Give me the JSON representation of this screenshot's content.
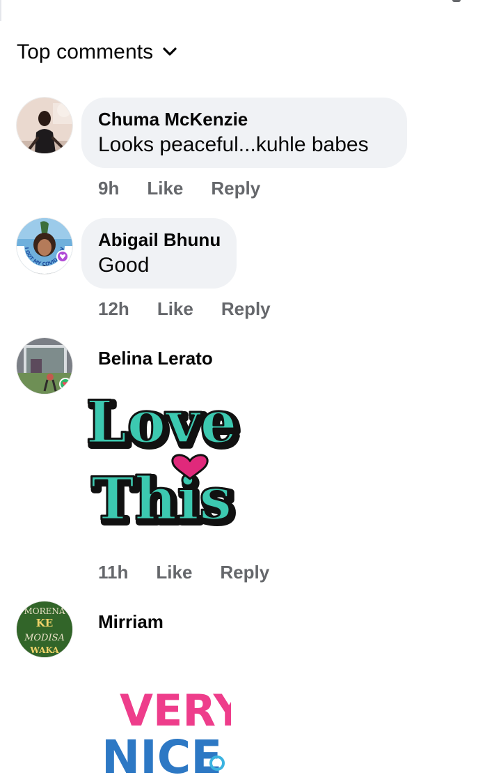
{
  "header": {
    "sort_label": "Top comments"
  },
  "comments": [
    {
      "author": "Chuma McKenzie",
      "text": "Looks peaceful...kuhle babes",
      "time": "9h",
      "like": "Like",
      "reply": "Reply"
    },
    {
      "author": "Abigail Bhunu",
      "text": "Good",
      "time": "12h",
      "like": "Like",
      "reply": "Reply",
      "avatar_frame_text": "I GOT MY COVID-19 VACCINE"
    },
    {
      "author": "Belina Lerato",
      "sticker": {
        "line1": "Love",
        "line2": "This",
        "color": "#3cc9b0",
        "heart_color": "#e0297b"
      },
      "time": "11h",
      "like": "Like",
      "reply": "Reply"
    },
    {
      "author": "Mirriam",
      "avatar_text": {
        "line1": "MORENA",
        "line2": "KE",
        "line3": "MODISA",
        "line4": "WAKA"
      },
      "sticker": {
        "line1": "VERY",
        "line2": "NICE",
        "color_top": "#ee3d8b",
        "color_bottom": "#2d78c4"
      }
    }
  ],
  "colors": {
    "bubble": "#f0f2f5",
    "meta_text": "#65676b",
    "text": "#050505"
  }
}
